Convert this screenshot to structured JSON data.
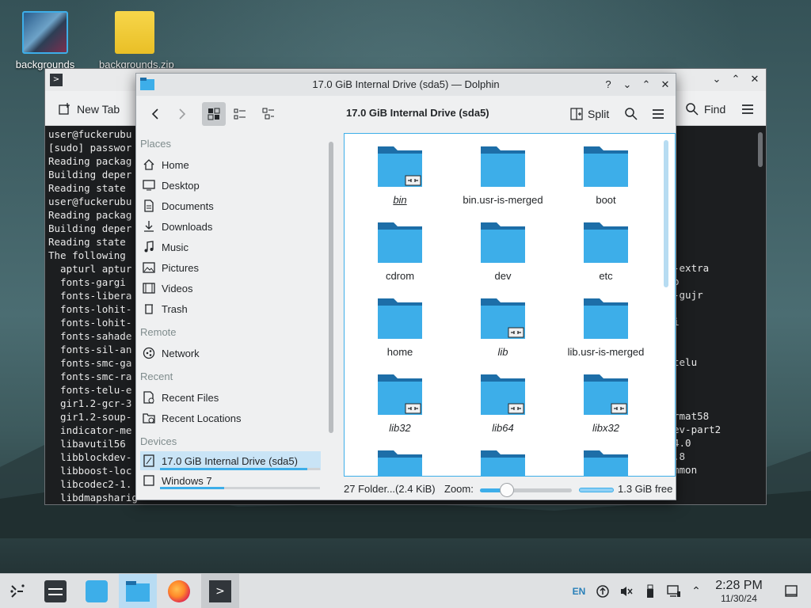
{
  "desktop": {
    "icons": [
      {
        "label": "backgrounds"
      },
      {
        "label": "backgrounds.zip"
      }
    ]
  },
  "konsole": {
    "new_tab_label": "New Tab",
    "find_label": "Find",
    "lines": [
      "user@fuckerubu",
      "[sudo] passwor",
      "Reading packag",
      "Building deper",
      "Reading state",
      "user@fuckerubu",
      "Reading packag",
      "Building deper",
      "Reading state",
      "The following",
      "  apturl aptur",
      "  fonts-gargi",
      "  fonts-libera",
      "  fonts-lohit-",
      "  fonts-lohit-",
      "  fonts-sahade",
      "  fonts-sil-an",
      "  fonts-smc-ga",
      "  fonts-smc-ra",
      "  fonts-telu-e",
      "  gir1.2-gcr-3",
      "  gir1.2-soup-",
      "  indicator-me",
      "  libavutil56",
      "  libblockdev-",
      "  libboost-loc",
      "  libcodec2-1.",
      "  libdmapsharig"
    ],
    "right_lines": [
      "-extra",
      "o",
      "-gujr",
      "",
      "i",
      "",
      "",
      "telu",
      "",
      "",
      "",
      "rmat58",
      "ev-part2",
      "4.0",
      ".8",
      "mmon"
    ]
  },
  "dolphin": {
    "window_title": "17.0 GiB Internal Drive (sda5) — Dolphin",
    "location": "17.0 GiB Internal Drive (sda5)",
    "split_label": "Split",
    "places": {
      "places_header": "Places",
      "remote_header": "Remote",
      "recent_header": "Recent",
      "devices_header": "Devices",
      "home": "Home",
      "desktop": "Desktop",
      "documents": "Documents",
      "downloads": "Downloads",
      "music": "Music",
      "pictures": "Pictures",
      "videos": "Videos",
      "trash": "Trash",
      "network": "Network",
      "recent_files": "Recent Files",
      "recent_locations": "Recent Locations",
      "drive_sda5": "17.0 GiB Internal Drive (sda5)",
      "windows7": "Windows 7"
    },
    "folders": [
      {
        "name": "bin",
        "link": true
      },
      {
        "name": "bin.usr-is-merged",
        "link": false
      },
      {
        "name": "boot",
        "link": false
      },
      {
        "name": "cdrom",
        "link": false
      },
      {
        "name": "dev",
        "link": false
      },
      {
        "name": "etc",
        "link": false
      },
      {
        "name": "home",
        "link": false
      },
      {
        "name": "lib",
        "link": true
      },
      {
        "name": "lib.usr-is-merged",
        "link": false
      },
      {
        "name": "lib32",
        "link": true
      },
      {
        "name": "lib64",
        "link": true
      },
      {
        "name": "libx32",
        "link": true
      }
    ],
    "status": {
      "count": "27 Folder...(2.4 KiB)",
      "zoom_label": "Zoom:",
      "zoom_fraction": 0.29,
      "free_label": "1.3 GiB free"
    },
    "drive_usage": {
      "sda5_used_fraction": 0.92,
      "windows7_used_fraction": 0.4
    }
  },
  "taskbar": {
    "lang": "EN",
    "time": "2:28 PM",
    "date": "11/30/24"
  },
  "colors": {
    "accent": "#3daee9",
    "folder": "#3daee9",
    "folder_tab": "#1d6ea8"
  }
}
